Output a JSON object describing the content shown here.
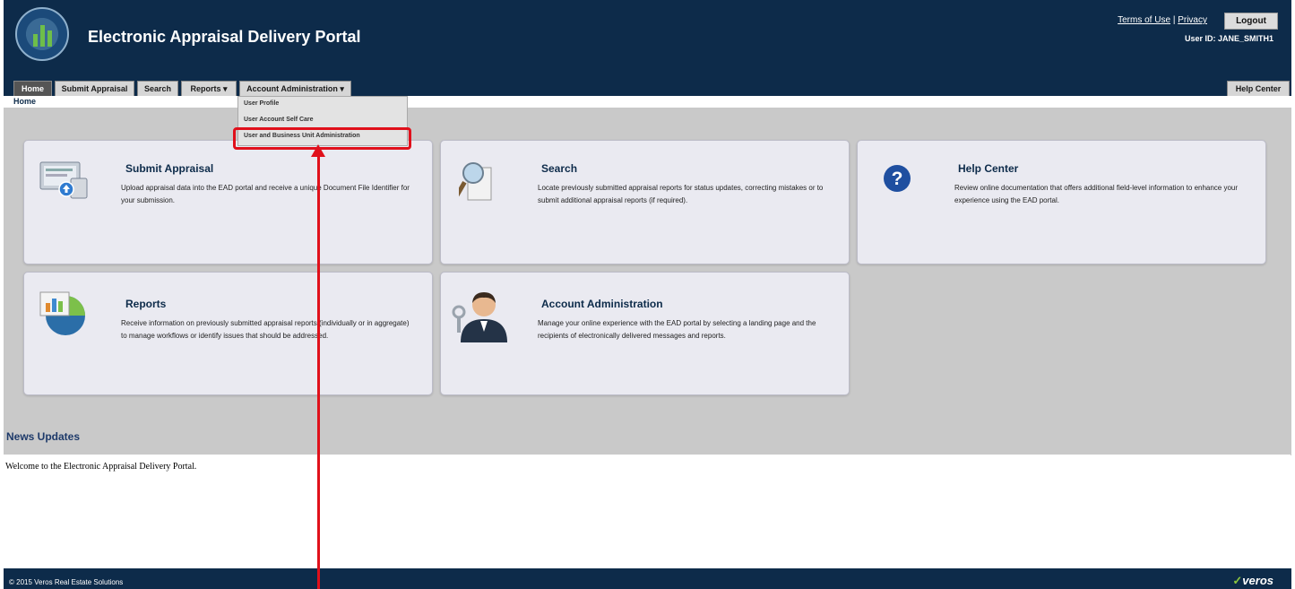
{
  "header": {
    "title": "Electronic Appraisal Delivery Portal",
    "terms_link": "Terms of Use",
    "separator": "|",
    "privacy_link": "Privacy",
    "logout_label": "Logout",
    "user_id": "User ID: JANE_SMITH1"
  },
  "nav": {
    "tabs": [
      {
        "label": "Home",
        "active": true
      },
      {
        "label": "Submit Appraisal"
      },
      {
        "label": "Search"
      },
      {
        "label": "Reports ▾"
      },
      {
        "label": "Account Administration ▾"
      }
    ],
    "help_center": "Help Center"
  },
  "dropdown": {
    "items": [
      "User Profile",
      "User Account Self Care",
      "User and Business Unit Administration"
    ]
  },
  "breadcrumb": "Home",
  "cards": [
    {
      "title": "Submit Appraisal",
      "desc": "Upload appraisal data into the EAD portal and receive a unique Document File Identifier for your submission.",
      "icon": "upload-computer-icon"
    },
    {
      "title": "Search",
      "desc": "Locate previously submitted appraisal reports for status updates, correcting mistakes or to submit additional appraisal reports (if required).",
      "icon": "magnifier-document-icon"
    },
    {
      "title": "Help Center",
      "desc": "Review online documentation that offers additional field-level information to enhance your experience using the EAD portal.",
      "icon": "question-mark-icon"
    },
    {
      "title": "Reports",
      "desc": "Receive information on previously submitted appraisal reports (individually or in aggregate) to manage workflows or identify issues that should be addressed.",
      "icon": "report-chart-icon"
    },
    {
      "title": "Account Administration",
      "desc": "Manage your online experience with the EAD portal by selecting a landing page and the recipients of electronically delivered messages and reports.",
      "icon": "user-key-icon"
    }
  ],
  "news": {
    "title": "News Updates",
    "body": "Welcome to the Electronic Appraisal Delivery Portal."
  },
  "footer": {
    "copyright": "© 2015 Veros Real Estate Solutions",
    "brand": "veros"
  },
  "colors": {
    "header": "#0d2b4a",
    "highlight": "#e0101b",
    "content_bg": "#c9c9c9"
  }
}
